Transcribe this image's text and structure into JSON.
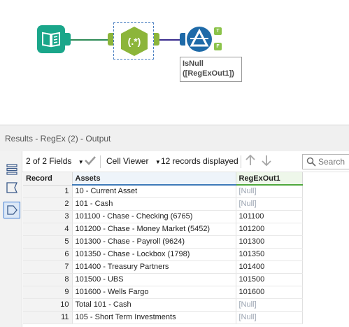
{
  "canvas": {
    "annotation_line1": "IsNull",
    "annotation_line2": "([RegExOut1])",
    "regex_symbol": "(.*)",
    "true_anchor": "T",
    "false_anchor": "F",
    "colors": {
      "input_tool": "#1aa68a",
      "regex_tool": "#8cb53a",
      "filter_tool": "#1e6aa8",
      "connector_green": "#2e8b57",
      "connector_purple": "#3a2c8e"
    }
  },
  "results": {
    "title": "Results - RegEx (2) - Output",
    "toolbar": {
      "fields": "2 of 2 Fields",
      "viewer": "Cell Viewer",
      "records": "12 records displayed",
      "search_placeholder": "Search"
    },
    "side_icons": [
      "list-view-icon",
      "message-icon",
      "tag-icon"
    ],
    "columns": [
      "Record",
      "Assets",
      "RegExOut1"
    ],
    "rows": [
      {
        "record": "1",
        "assets": "10 - Current Asset",
        "regex": "[Null]"
      },
      {
        "record": "2",
        "assets": "101 - Cash",
        "regex": "[Null]"
      },
      {
        "record": "3",
        "assets": "101100 - Chase - Checking (6765)",
        "regex": "101100"
      },
      {
        "record": "4",
        "assets": "101200 - Chase - Money Market (5452)",
        "regex": "101200"
      },
      {
        "record": "5",
        "assets": "101300 - Chase - Payroll (9624)",
        "regex": "101300"
      },
      {
        "record": "6",
        "assets": "101350 - Chase - Lockbox (1798)",
        "regex": "101350"
      },
      {
        "record": "7",
        "assets": "101400 - Treasury Partners",
        "regex": "101400"
      },
      {
        "record": "8",
        "assets": "101500 - UBS",
        "regex": "101500"
      },
      {
        "record": "9",
        "assets": "101600 - Wells Fargo",
        "regex": "101600"
      },
      {
        "record": "10",
        "assets": "Total 101 - Cash",
        "regex": "[Null]"
      },
      {
        "record": "11",
        "assets": "105 - Short Term Investments",
        "regex": "[Null]"
      }
    ]
  }
}
